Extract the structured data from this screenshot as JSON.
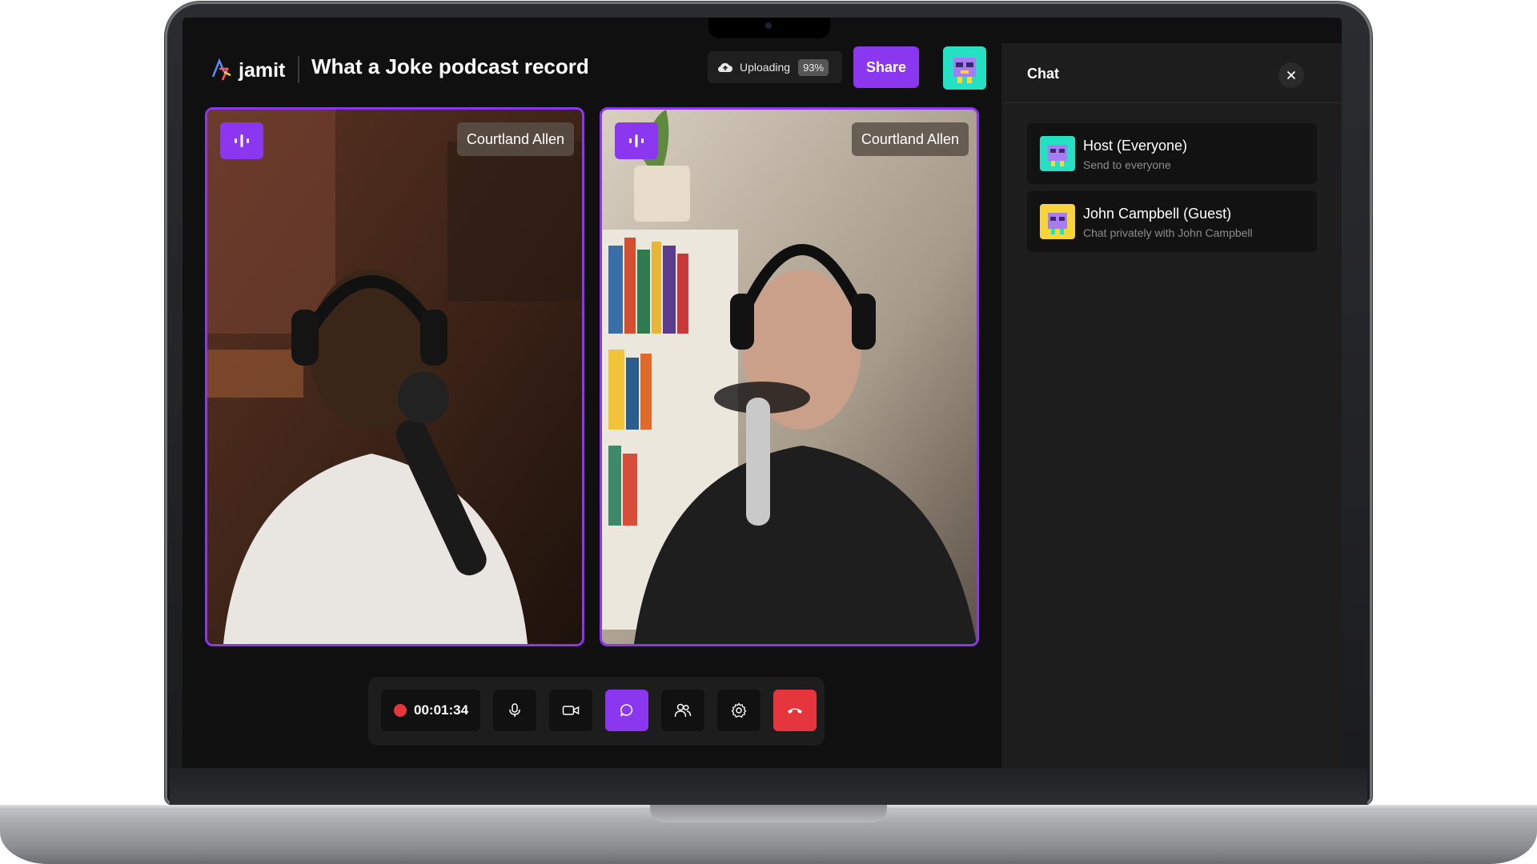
{
  "app": {
    "logo_text": "jamit",
    "title": "What a Joke podcast record"
  },
  "upload": {
    "label": "Uploading",
    "percent_text": "93%",
    "progress": 0.93
  },
  "header": {
    "share_label": "Share"
  },
  "videos": [
    {
      "name": "Courtland Allen"
    },
    {
      "name": "Courtland Allen"
    }
  ],
  "controls": {
    "timer": "00:01:34"
  },
  "chat": {
    "title": "Chat",
    "items": [
      {
        "name": "Host (Everyone)",
        "subtitle": "Send to everyone"
      },
      {
        "name": "John Campbell (Guest)",
        "subtitle": "Chat privately with John Campbell"
      }
    ]
  },
  "colors": {
    "accent": "#8b37f0",
    "end_call": "#e5353d",
    "panel": "#1d1d1d",
    "background": "#101010"
  },
  "icons": [
    "jamit-logo-icon",
    "cloud-upload-icon",
    "avatar-icon",
    "audio-level-icon",
    "microphone-icon",
    "camera-icon",
    "chat-icon",
    "participants-icon",
    "settings-icon",
    "hang-up-icon",
    "close-icon"
  ]
}
